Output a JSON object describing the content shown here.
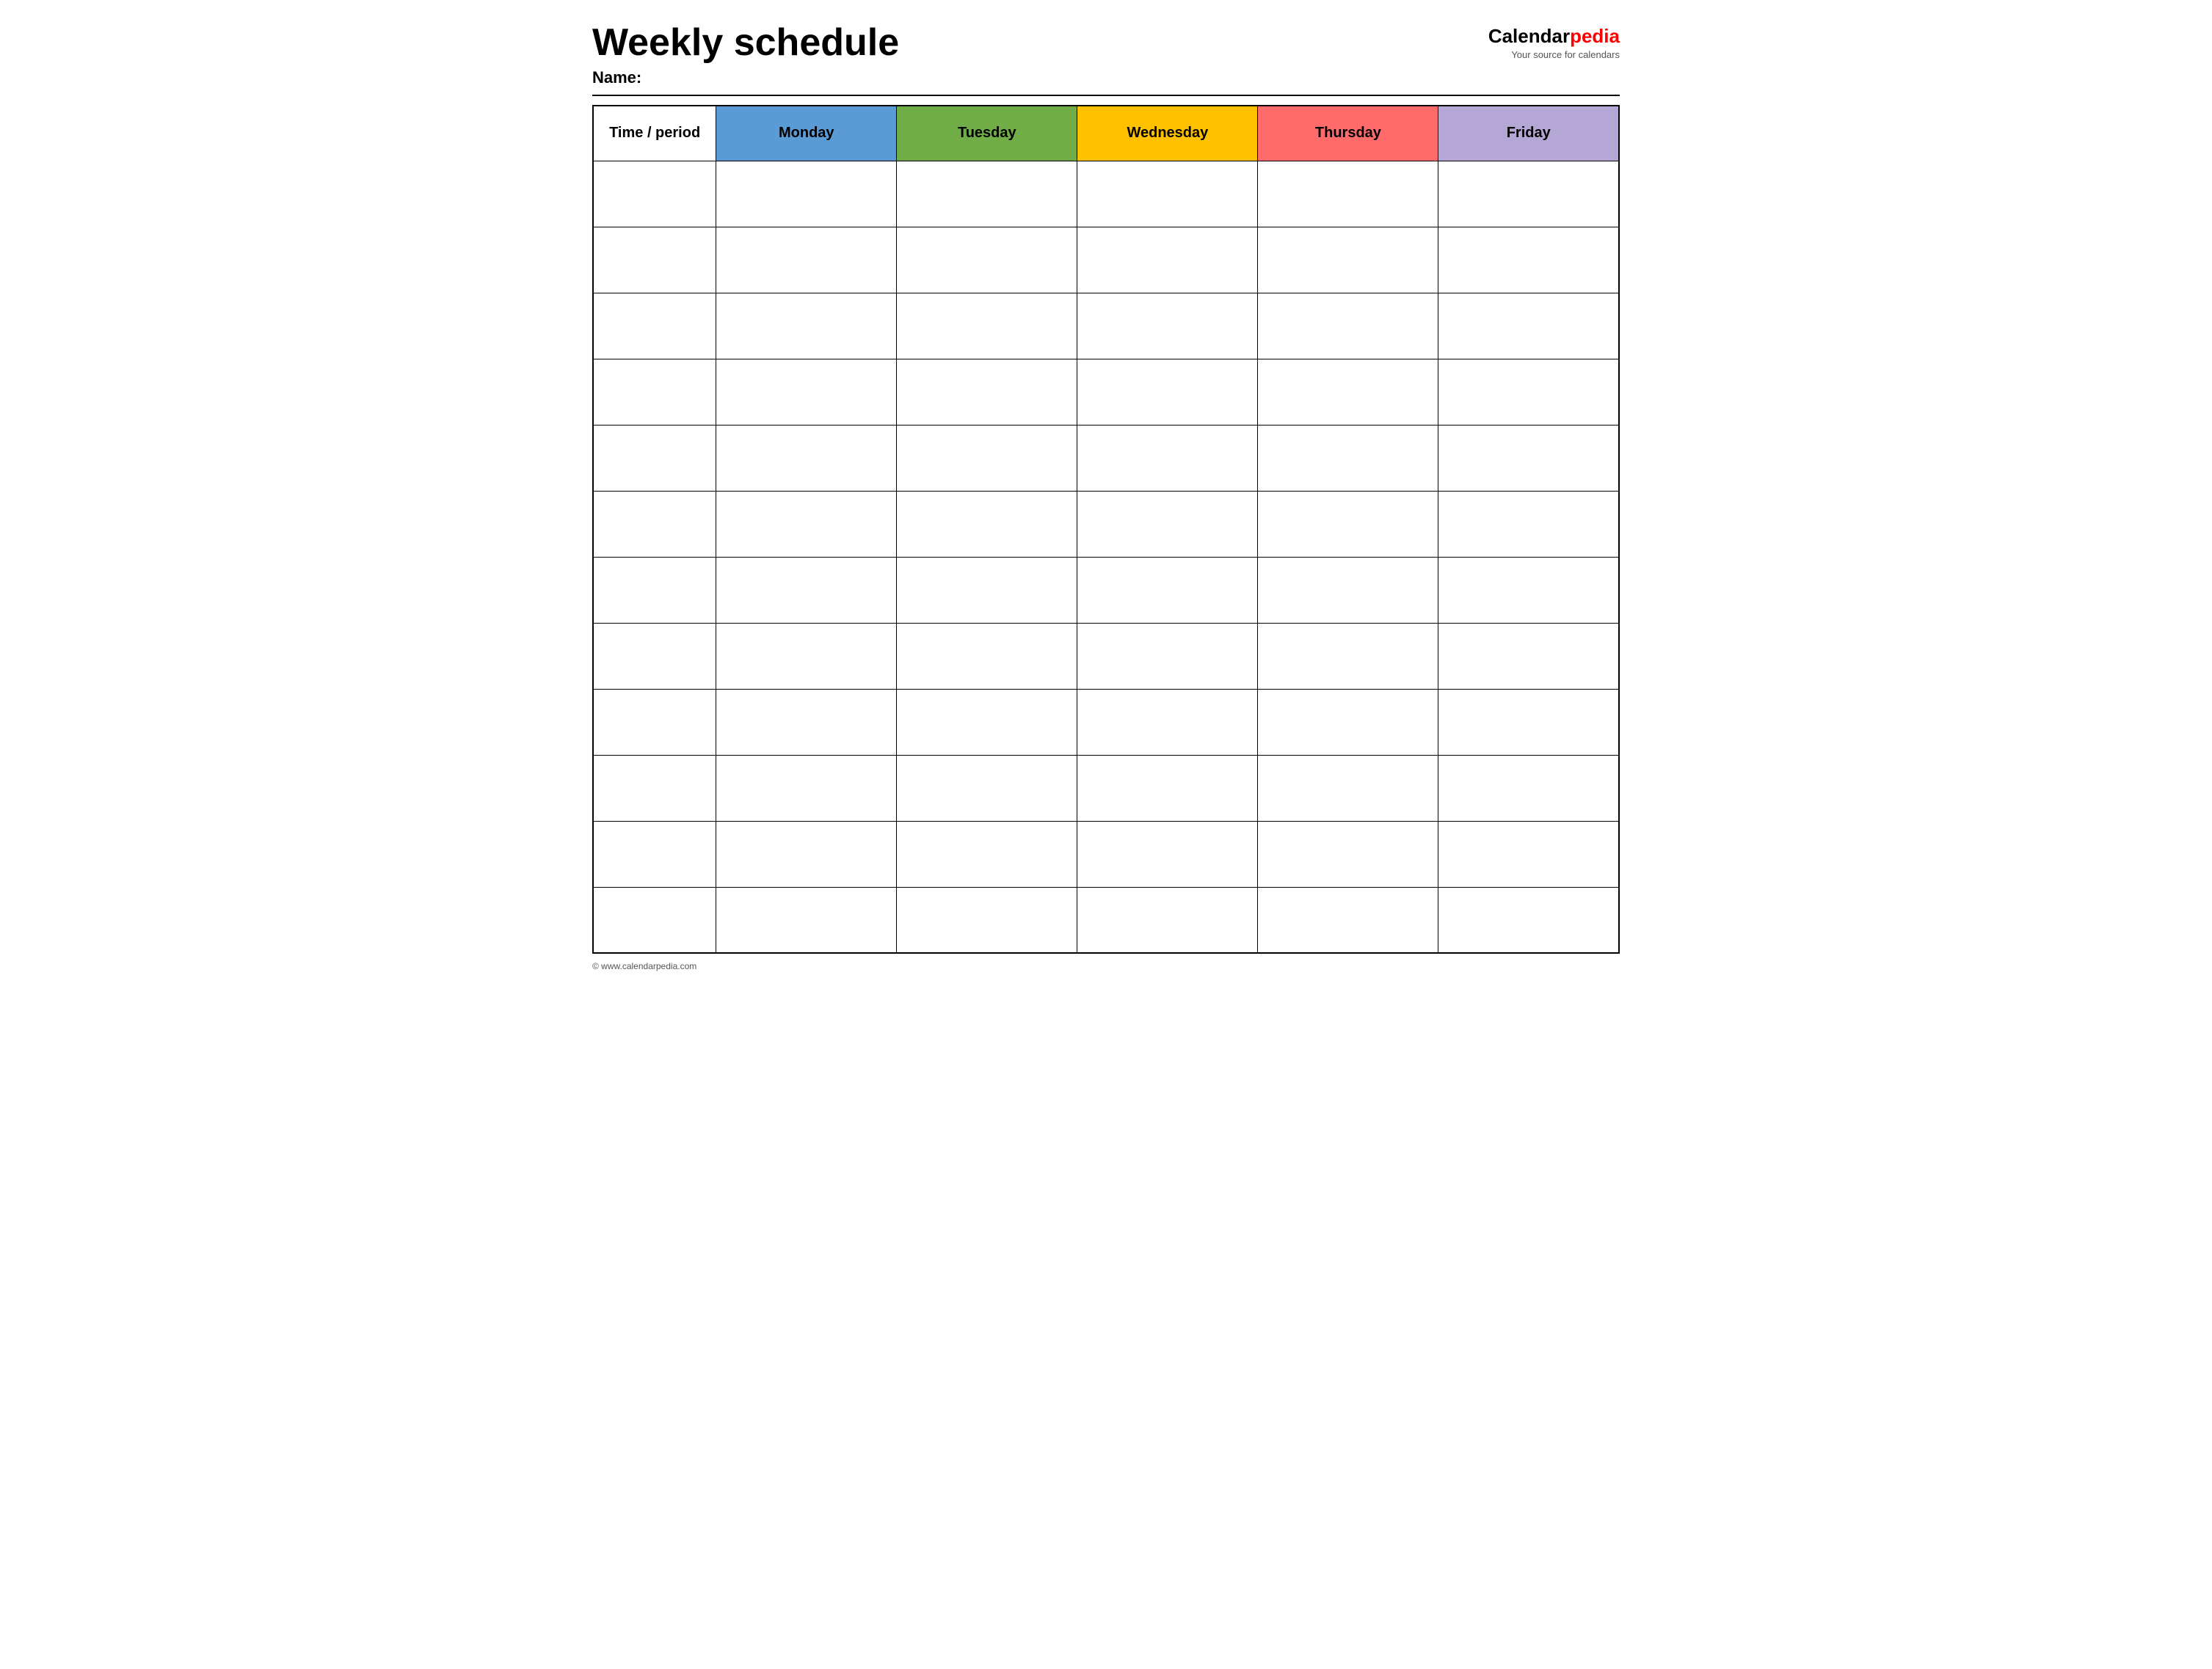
{
  "header": {
    "title": "Weekly schedule",
    "name_label": "Name:",
    "logo_calendar": "Calendar",
    "logo_pedia": "pedia",
    "logo_tagline": "Your source for calendars"
  },
  "table": {
    "columns": [
      {
        "key": "time",
        "label": "Time / period",
        "color": "#ffffff"
      },
      {
        "key": "monday",
        "label": "Monday",
        "color": "#5b9bd5"
      },
      {
        "key": "tuesday",
        "label": "Tuesday",
        "color": "#70ad47"
      },
      {
        "key": "wednesday",
        "label": "Wednesday",
        "color": "#ffc000"
      },
      {
        "key": "thursday",
        "label": "Thursday",
        "color": "#ff6b6b"
      },
      {
        "key": "friday",
        "label": "Friday",
        "color": "#b4a7d6"
      }
    ],
    "rows": 12
  },
  "footer": {
    "copyright": "© www.calendarpedia.com"
  }
}
